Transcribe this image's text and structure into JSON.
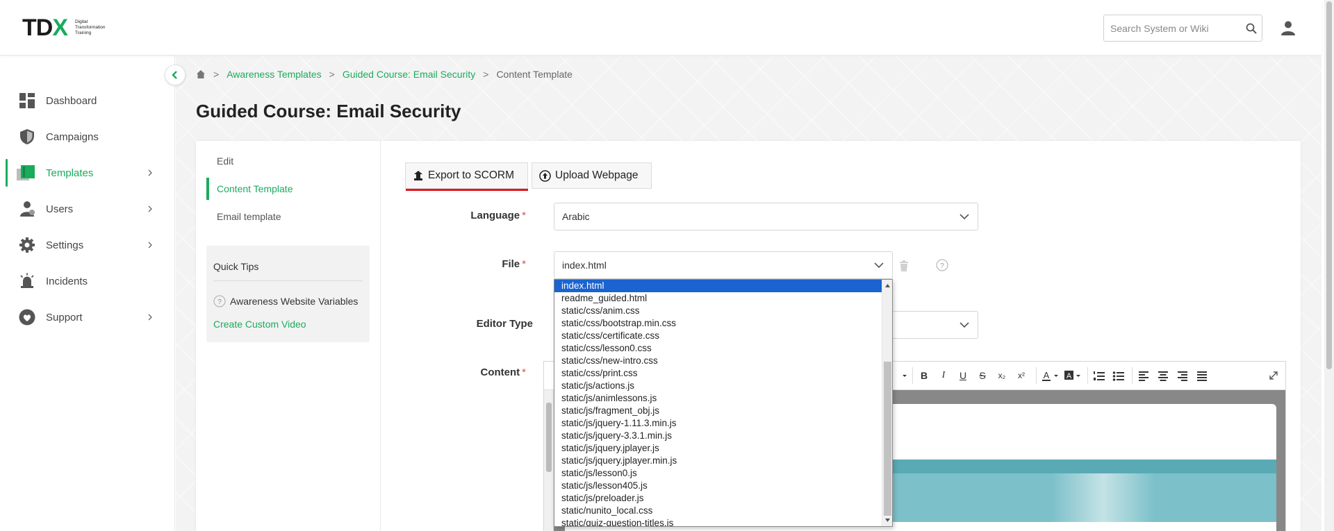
{
  "header": {
    "logo_letters": "TD",
    "logo_x": "X",
    "logo_tagline": "Digital Transformation Training",
    "search_placeholder": "Search System or Wiki"
  },
  "sidebar": {
    "items": [
      {
        "label": "Dashboard",
        "icon": "dashboard-icon"
      },
      {
        "label": "Campaigns",
        "icon": "shield-icon"
      },
      {
        "label": "Templates",
        "icon": "templates-icon",
        "active": true
      },
      {
        "label": "Users",
        "icon": "users-icon"
      },
      {
        "label": "Settings",
        "icon": "gear-icon"
      },
      {
        "label": "Incidents",
        "icon": "alarm-icon"
      },
      {
        "label": "Support",
        "icon": "heart-icon"
      }
    ]
  },
  "breadcrumb": {
    "items": [
      "Awareness Templates",
      "Guided Course: Email Security"
    ],
    "current": "Content Template",
    "separator": ">"
  },
  "page": {
    "title": "Guided Course: Email Security"
  },
  "subnav": {
    "items": [
      "Edit",
      "Content Template",
      "Email template"
    ],
    "active_index": 1
  },
  "tips": {
    "title": "Quick Tips",
    "variables_label": "Awareness Website Variables",
    "video_label": "Create Custom Video"
  },
  "actions": {
    "export_label": "Export to SCORM",
    "upload_label": "Upload Webpage"
  },
  "form": {
    "language_label": "Language",
    "language_value": "Arabic",
    "file_label": "File",
    "file_value": "index.html",
    "editor_type_label": "Editor Type",
    "content_label": "Content",
    "required_mark": "*"
  },
  "file_options": [
    "index.html",
    "readme_guided.html",
    "static/css/anim.css",
    "static/css/bootstrap.min.css",
    "static/css/certificate.css",
    "static/css/lesson0.css",
    "static/css/new-intro.css",
    "static/css/print.css",
    "static/js/actions.js",
    "static/js/animlessons.js",
    "static/js/fragment_obj.js",
    "static/js/jquery-1.11.3.min.js",
    "static/js/jquery-3.3.1.min.js",
    "static/js/jquery.jplayer.js",
    "static/js/jquery.jplayer.min.js",
    "static/js/lesson0.js",
    "static/js/lesson405.js",
    "static/js/preloader.js",
    "static/nunito_local.css",
    "static/quiz-question-titles.js"
  ],
  "editor_toolbar": {
    "bold": "B",
    "italic": "I",
    "underline": "U",
    "strike": "S",
    "subscript": "x₂",
    "superscript": "x²"
  },
  "colors": {
    "accent": "#1aab5c",
    "danger": "#e2141d",
    "selection": "#1a63d0",
    "banner": "#7cc0c9"
  }
}
